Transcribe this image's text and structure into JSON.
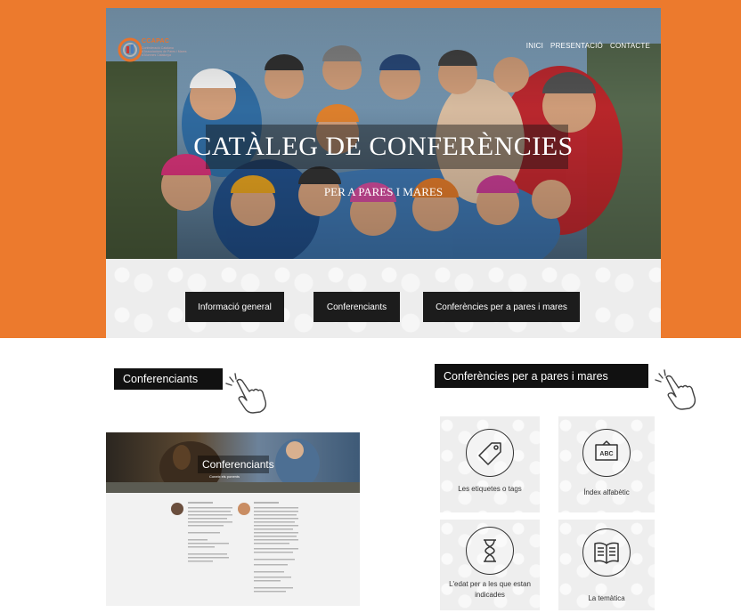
{
  "site": {
    "logo_name": "CCAPAC",
    "logo_tagline": "Confederació Catalana d'Associacions de Pares i Mares d'Alumnes Catalunya",
    "nav": [
      "INICI",
      "PRESENTACIÓ",
      "CONTACTE"
    ],
    "hero_title": "CATÀLEG DE CONFERÈNCIES",
    "hero_subtitle": "PER A PARES I MARES",
    "buttons": [
      "Informació general",
      "Conferenciants",
      "Conferències per a pares i mares"
    ]
  },
  "labels": {
    "left": "Conferenciants",
    "right": "Conferències per a pares i mares"
  },
  "mini_page": {
    "title": "Conferenciants",
    "subtitle": "Coneix els ponents"
  },
  "tiles": [
    {
      "label": "Les etiquetes o tags",
      "icon": "tag-icon"
    },
    {
      "label": "Índex alfabètic",
      "icon": "abc-sign-icon"
    },
    {
      "label": "L'edat per a les que estan indicades",
      "icon": "hourglass-icon"
    },
    {
      "label": "La temàtica",
      "icon": "open-book-icon"
    }
  ],
  "colors": {
    "orange_frame": "#ec7a2d",
    "button_dark": "#1c1c1c",
    "tile_bg": "#eeeeee"
  }
}
